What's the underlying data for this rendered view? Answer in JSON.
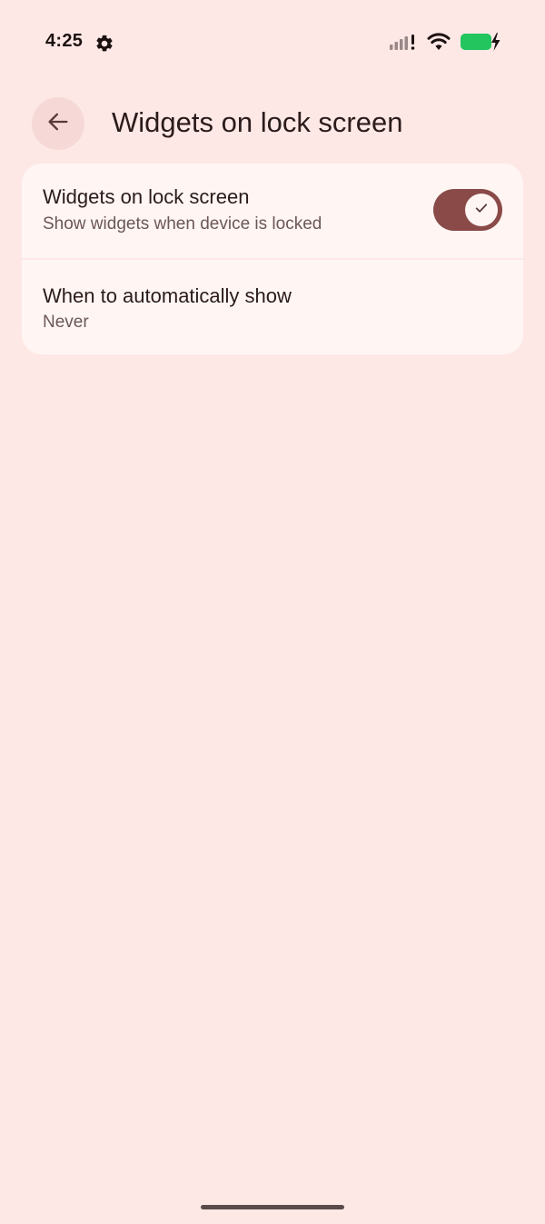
{
  "status_bar": {
    "time": "4:25",
    "settings_icon": "gear-icon",
    "signal_icon": "signal-bars-no-data-icon",
    "wifi_icon": "wifi-icon",
    "battery_icon": "battery-charging-icon"
  },
  "app_bar": {
    "back_icon": "arrow-left-icon",
    "title": "Widgets on lock screen"
  },
  "settings": {
    "items": [
      {
        "title": "Widgets on lock screen",
        "subtitle": "Show widgets when device is locked",
        "toggle_on": true
      },
      {
        "title": "When to automatically show",
        "subtitle": "Never"
      }
    ]
  },
  "colors": {
    "background": "#fde8e6",
    "card": "#fff6f4",
    "toggle_track": "#8a4a48",
    "battery": "#22c55e"
  }
}
